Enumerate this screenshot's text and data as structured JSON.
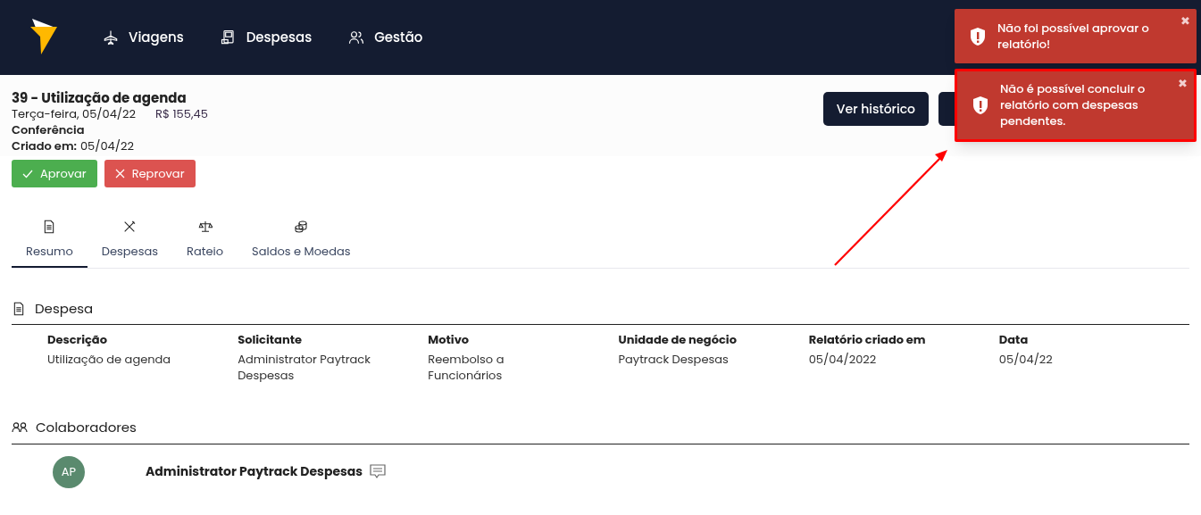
{
  "nav": {
    "items": [
      {
        "label": "Viagens",
        "kind": "plane"
      },
      {
        "label": "Despesas",
        "kind": "receipt"
      },
      {
        "label": "Gestão",
        "kind": "users"
      }
    ]
  },
  "report": {
    "title": "39 - Utilização de agenda",
    "date": "Terça-feira, 05/04/22",
    "amount": "R$ 155,45",
    "stage": "Conferência",
    "created_label": "Criado em:",
    "created_value": "05/04/22"
  },
  "header_buttons": [
    {
      "kind": "history",
      "label": "Ver histórico"
    },
    {
      "kind": "covered"
    }
  ],
  "actions": [
    {
      "label": "Aprovar",
      "kind": "approve"
    },
    {
      "label": "Reprovar",
      "kind": "reject"
    }
  ],
  "tabs": [
    {
      "label": "Resumo",
      "kind": "doc",
      "selected": true
    },
    {
      "label": "Despesas",
      "kind": "cutlery",
      "selected": false
    },
    {
      "label": "Rateio",
      "kind": "scale",
      "selected": false
    },
    {
      "label": "Saldos e Moedas",
      "kind": "coins",
      "selected": false
    }
  ],
  "expense_section": {
    "title": "Despesa",
    "fields": [
      {
        "label": "Descrição",
        "value": "Utilização de agenda"
      },
      {
        "label": "Solicitante",
        "value": "Administrator Paytrack Despesas"
      },
      {
        "label": "Motivo",
        "value": "Reembolso a Funcionários"
      },
      {
        "label": "Unidade de negócio",
        "value": "Paytrack Despesas"
      },
      {
        "label": "Relatório criado em",
        "value": "05/04/2022"
      },
      {
        "label": "Data",
        "value": "05/04/22"
      }
    ]
  },
  "collaborators_section": {
    "title": "Colaboradores",
    "people": [
      {
        "initials": "AP",
        "name": "Administrator Paytrack Despesas"
      }
    ]
  },
  "toasts": [
    {
      "message": "Não foi possível aprovar o relatório!",
      "highlighted": false
    },
    {
      "message": "Não é possível concluir o relatório com despesas pendentes.",
      "highlighted": true
    }
  ],
  "toast_close": [
    "✖",
    "✖"
  ]
}
